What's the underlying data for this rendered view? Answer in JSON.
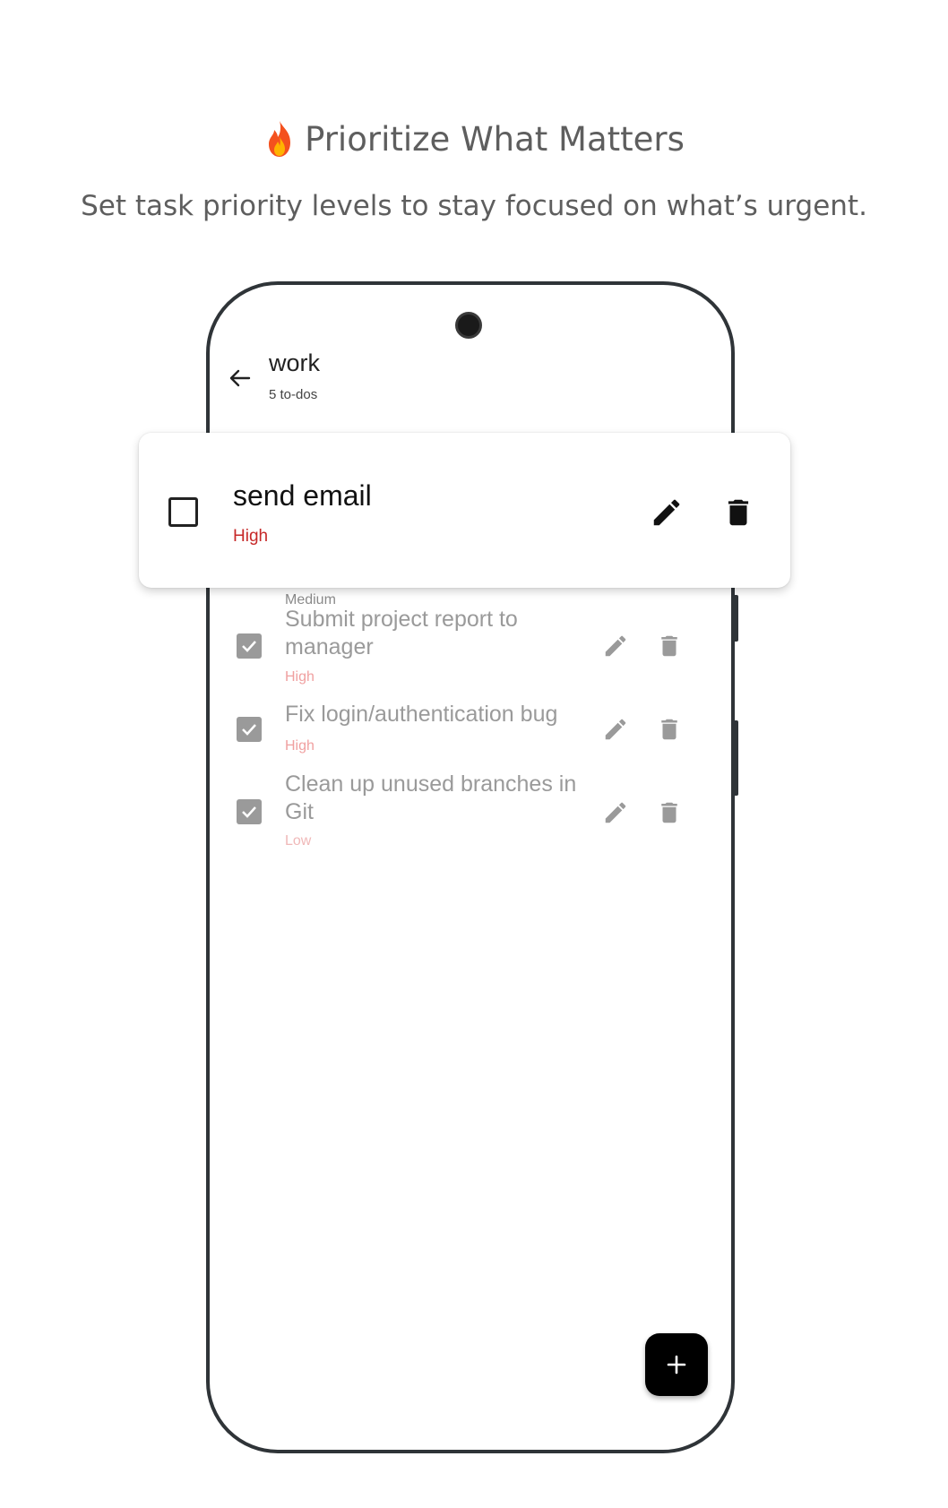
{
  "header": {
    "icon": "fire-emoji",
    "title": "Prioritize What Matters",
    "subtitle": "Set task priority levels to stay focused on what’s urgent."
  },
  "app_bar": {
    "back_icon": "arrow-left-icon",
    "list_name": "work",
    "count_label": "5 to-dos"
  },
  "highlighted_task": {
    "title": "send email",
    "priority": "High",
    "completed": false,
    "priority_color": "#c62828"
  },
  "partially_hidden_priority": "Medium",
  "todos": [
    {
      "title": "Submit project report to manager",
      "priority": "High",
      "completed": true
    },
    {
      "title": "Fix login/authentication bug",
      "priority": "High",
      "completed": true
    },
    {
      "title": "Clean up unused branches in Git",
      "priority": "Low",
      "completed": true
    }
  ],
  "fab": {
    "icon": "plus-icon",
    "color": "#000000"
  },
  "colors": {
    "headline_text": "#5e5e5e",
    "phone_frame": "#2f3438",
    "done_text": "#9a9a9a"
  }
}
